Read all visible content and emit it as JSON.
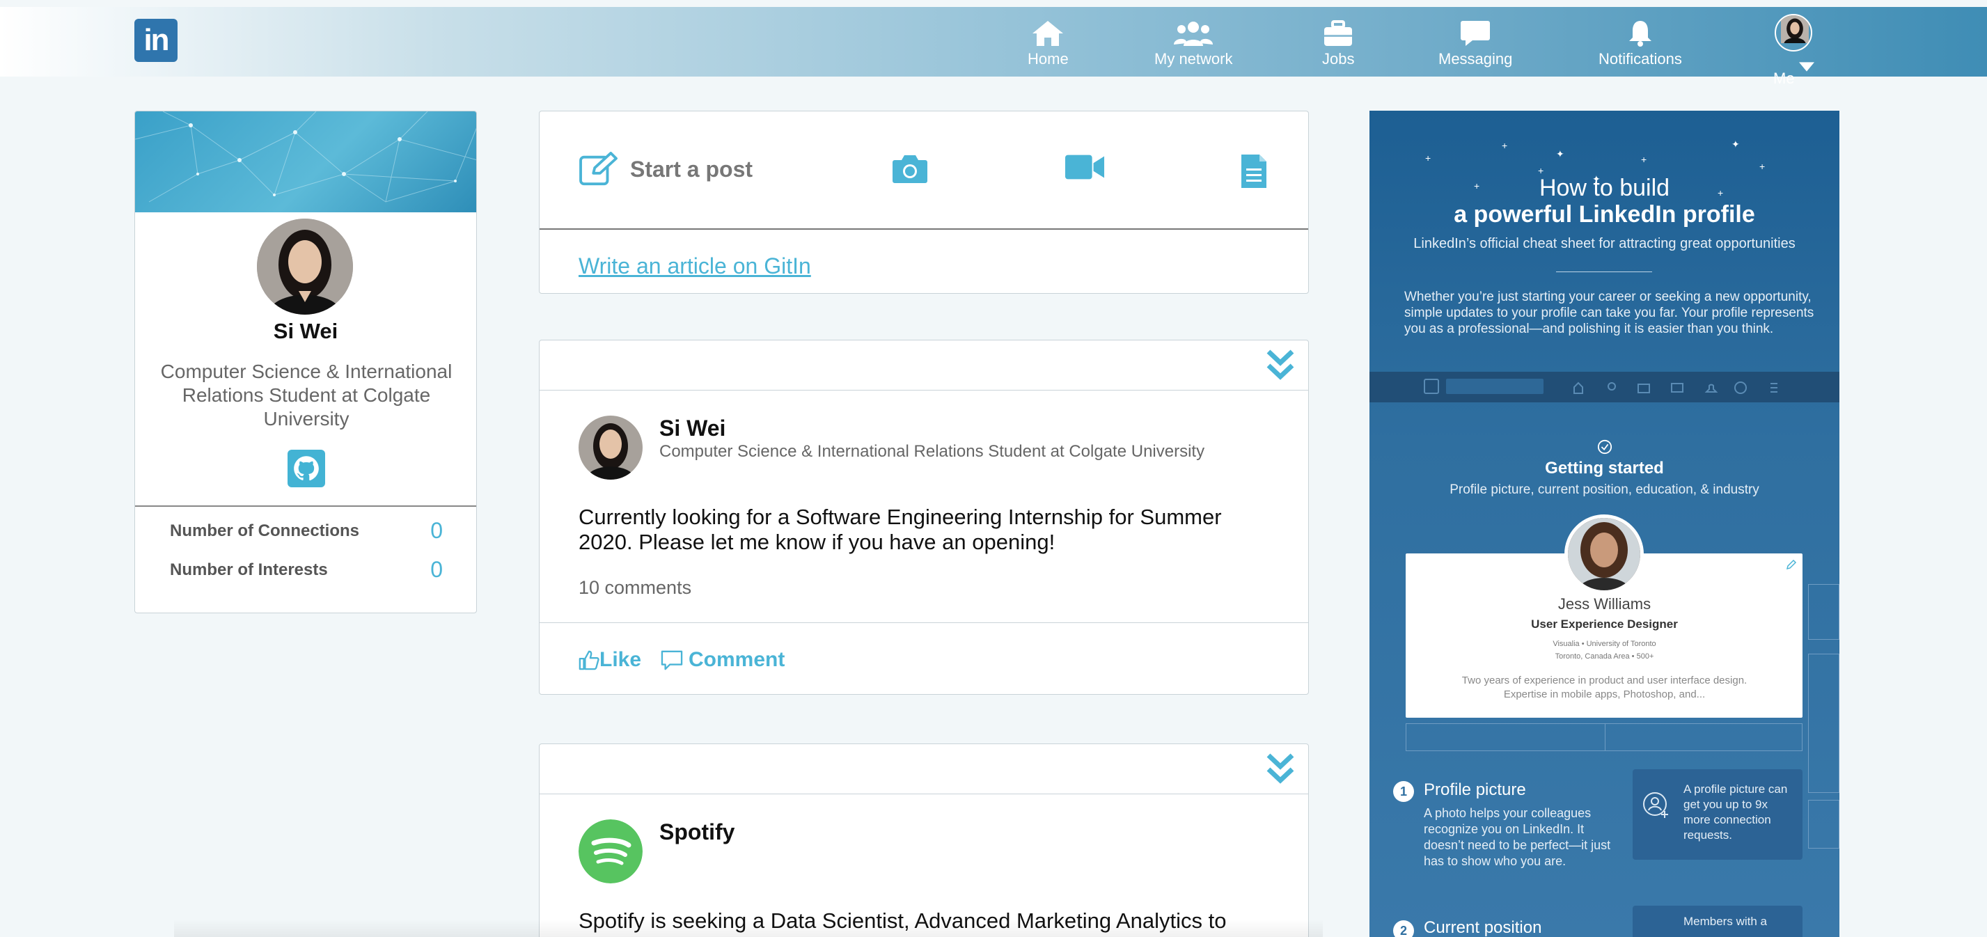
{
  "nav": {
    "logo": "in",
    "items": [
      {
        "label": "Home",
        "icon": "home-icon"
      },
      {
        "label": "My network",
        "icon": "network-icon"
      },
      {
        "label": "Jobs",
        "icon": "briefcase-icon"
      },
      {
        "label": "Messaging",
        "icon": "message-icon"
      },
      {
        "label": "Notifications",
        "icon": "bell-icon"
      }
    ],
    "me_label": "Me"
  },
  "profile": {
    "name": "Si Wei",
    "headline": "Computer Science & International Relations Student at Colgate University",
    "stats": [
      {
        "label": "Number of Connections",
        "value": "0"
      },
      {
        "label": "Number of Interests",
        "value": "0"
      }
    ]
  },
  "composer": {
    "start_post_label": "Start a post",
    "write_article_label": "Write an article on GitIn"
  },
  "feed": [
    {
      "author": "Si Wei",
      "subtitle": "Computer Science & International Relations Student at Colgate University",
      "text": "Currently looking for a Software Engineering Internship for Summer 2020. Please let me know if you have an opening!",
      "comments": "10 comments",
      "like_label": "Like",
      "comment_label": "Comment"
    },
    {
      "author": "Spotify",
      "text": "Spotify is seeking a Data Scientist, Advanced Marketing Analytics to"
    }
  ],
  "ad": {
    "title_line1": "How to build",
    "title_line2": "a powerful LinkedIn profile",
    "subtitle": "LinkedIn’s official cheat sheet for attracting great opportunities",
    "paragraph": "Whether you’re just starting your career or seeking a new opportunity, simple updates to your profile can take you far. Your profile represents you as a professional—and polishing it is easier than you think.",
    "getting_started": "Getting started",
    "getting_started_sub": "Profile picture, current position, education, & industry",
    "sample_name": "Jess Williams",
    "sample_title": "User Experience Designer",
    "sample_meta1": "Visualia  •  University of Toronto",
    "sample_meta2": "Toronto, Canada Area  •  500+",
    "sample_bio1": "Two years of experience in product and user interface design.",
    "sample_bio2": "Expertise in mobile apps, Photoshop, and...",
    "step1_num": "1",
    "step1_title": "Profile picture",
    "step1_text": "A photo helps your colleagues recognize you on LinkedIn. It doesn’t need to be perfect—it just has to show who you are.",
    "tip1": "A profile picture can get you up to 9x more connection requests.",
    "step2_num": "2",
    "step2_title": "Current position",
    "tip2": "Members with a"
  },
  "colors": {
    "accent": "#4ab4d6",
    "brand": "#2f75ad",
    "spotify": "#57c460"
  }
}
